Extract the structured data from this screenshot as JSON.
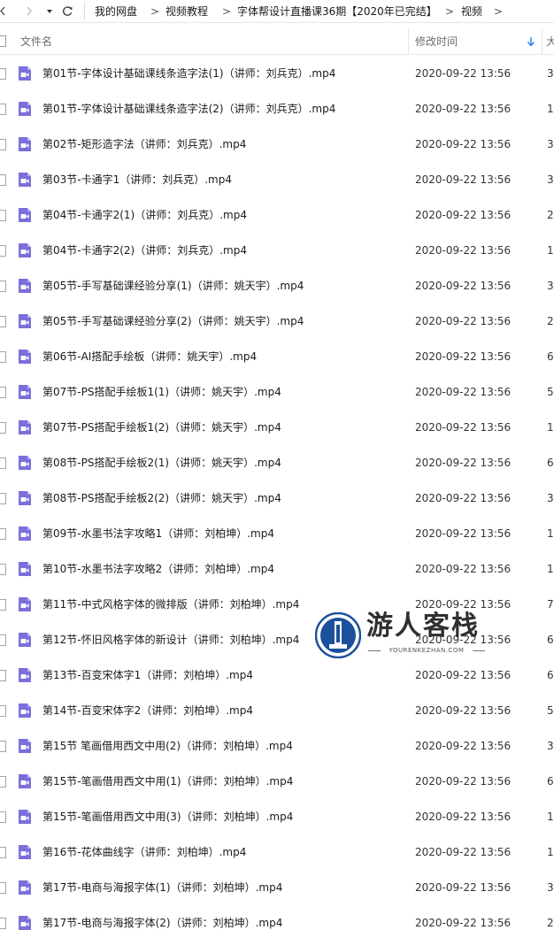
{
  "nav": {
    "back_icon": "chevron-left-icon",
    "forward_icon": "chevron-right-icon",
    "dropdown_icon": "caret-down-icon",
    "refresh_icon": "refresh-icon",
    "breadcrumbs": [
      "我的网盘",
      "视频教程",
      "字体帮设计直播课36期【2020年已完结】",
      "视频"
    ],
    "separator": ">"
  },
  "header": {
    "name_label": "文件名",
    "modified_label": "修改时间",
    "size_label": "大",
    "sort_icon": "sort-down-arrow-icon"
  },
  "files": [
    {
      "name": "第01节-字体设计基础课线条造字法(1)（讲师：刘兵克）.mp4",
      "modified": "2020-09-22 13:56",
      "size": "3"
    },
    {
      "name": "第01节-字体设计基础课线条造字法(2)（讲师：刘兵克）.mp4",
      "modified": "2020-09-22 13:56",
      "size": "1"
    },
    {
      "name": "第02节-矩形造字法（讲师：刘兵克）.mp4",
      "modified": "2020-09-22 13:56",
      "size": "3"
    },
    {
      "name": "第03节-卡通字1（讲师：刘兵克）.mp4",
      "modified": "2020-09-22 13:56",
      "size": "3"
    },
    {
      "name": "第04节-卡通字2(1)（讲师：刘兵克）.mp4",
      "modified": "2020-09-22 13:56",
      "size": "2"
    },
    {
      "name": "第04节-卡通字2(2)（讲师：刘兵克）.mp4",
      "modified": "2020-09-22 13:56",
      "size": "1"
    },
    {
      "name": "第05节-手写基础课经验分享(1)（讲师：姚天宇）.mp4",
      "modified": "2020-09-22 13:56",
      "size": "3"
    },
    {
      "name": "第05节-手写基础课经验分享(2)（讲师：姚天宇）.mp4",
      "modified": "2020-09-22 13:56",
      "size": "2"
    },
    {
      "name": "第06节-AI搭配手绘板（讲师：姚天宇）.mp4",
      "modified": "2020-09-22 13:56",
      "size": "6"
    },
    {
      "name": "第07节-PS搭配手绘板1(1)（讲师：姚天宇）.mp4",
      "modified": "2020-09-22 13:56",
      "size": "5"
    },
    {
      "name": "第07节-PS搭配手绘板1(2)（讲师：姚天宇）.mp4",
      "modified": "2020-09-22 13:56",
      "size": "1"
    },
    {
      "name": "第08节-PS搭配手绘板2(1)（讲师：姚天宇）.mp4",
      "modified": "2020-09-22 13:56",
      "size": "6"
    },
    {
      "name": "第08节-PS搭配手绘板2(2)（讲师：姚天宇）.mp4",
      "modified": "2020-09-22 13:56",
      "size": "3"
    },
    {
      "name": "第09节-水墨书法字攻略1（讲师：刘柏坤）.mp4",
      "modified": "2020-09-22 13:56",
      "size": "1"
    },
    {
      "name": "第10节-水墨书法字攻略2（讲师：刘柏坤）.mp4",
      "modified": "2020-09-22 13:56",
      "size": "1"
    },
    {
      "name": "第11节-中式风格字体的微排版（讲师：刘柏坤）.mp4",
      "modified": "2020-09-22 13:56",
      "size": "7"
    },
    {
      "name": "第12节-怀旧风格字体的新设计（讲师：刘柏坤）.mp4",
      "modified": "2020-09-22 13:56",
      "size": "6"
    },
    {
      "name": "第13节-百变宋体字1（讲师：刘柏坤）.mp4",
      "modified": "2020-09-22 13:56",
      "size": "6"
    },
    {
      "name": "第14节-百变宋体字2（讲师：刘柏坤）.mp4",
      "modified": "2020-09-22 13:56",
      "size": "5"
    },
    {
      "name": "第15节 笔画借用西文中用(2)（讲师：刘柏坤）.mp4",
      "modified": "2020-09-22 13:56",
      "size": "3"
    },
    {
      "name": "第15节-笔画借用西文中用(1)（讲师：刘柏坤）.mp4",
      "modified": "2020-09-22 13:56",
      "size": "6"
    },
    {
      "name": "第15节-笔画借用西文中用(3)（讲师：刘柏坤）.mp4",
      "modified": "2020-09-22 13:56",
      "size": "1"
    },
    {
      "name": "第16节-花体曲线字（讲师：刘柏坤）.mp4",
      "modified": "2020-09-22 13:56",
      "size": "1"
    },
    {
      "name": "第17节-电商与海报字体(1)（讲师：刘柏坤）.mp4",
      "modified": "2020-09-22 13:56",
      "size": "3"
    },
    {
      "name": "第17节-电商与海报字体(2)（讲师：刘柏坤）.mp4",
      "modified": "2020-09-22 13:56",
      "size": "2"
    }
  ],
  "file_icon": "video-file-icon",
  "watermark": {
    "title": "游人客栈",
    "subtitle": "YOURENKEZHAN.COM",
    "logo_icon": "yourenkezhan-logo-icon"
  },
  "colors": {
    "icon_purple": "#7b6fdb",
    "sort_blue": "#2b7fe0",
    "header_text": "#6d6d6d",
    "row_text": "#1a1a1a"
  }
}
